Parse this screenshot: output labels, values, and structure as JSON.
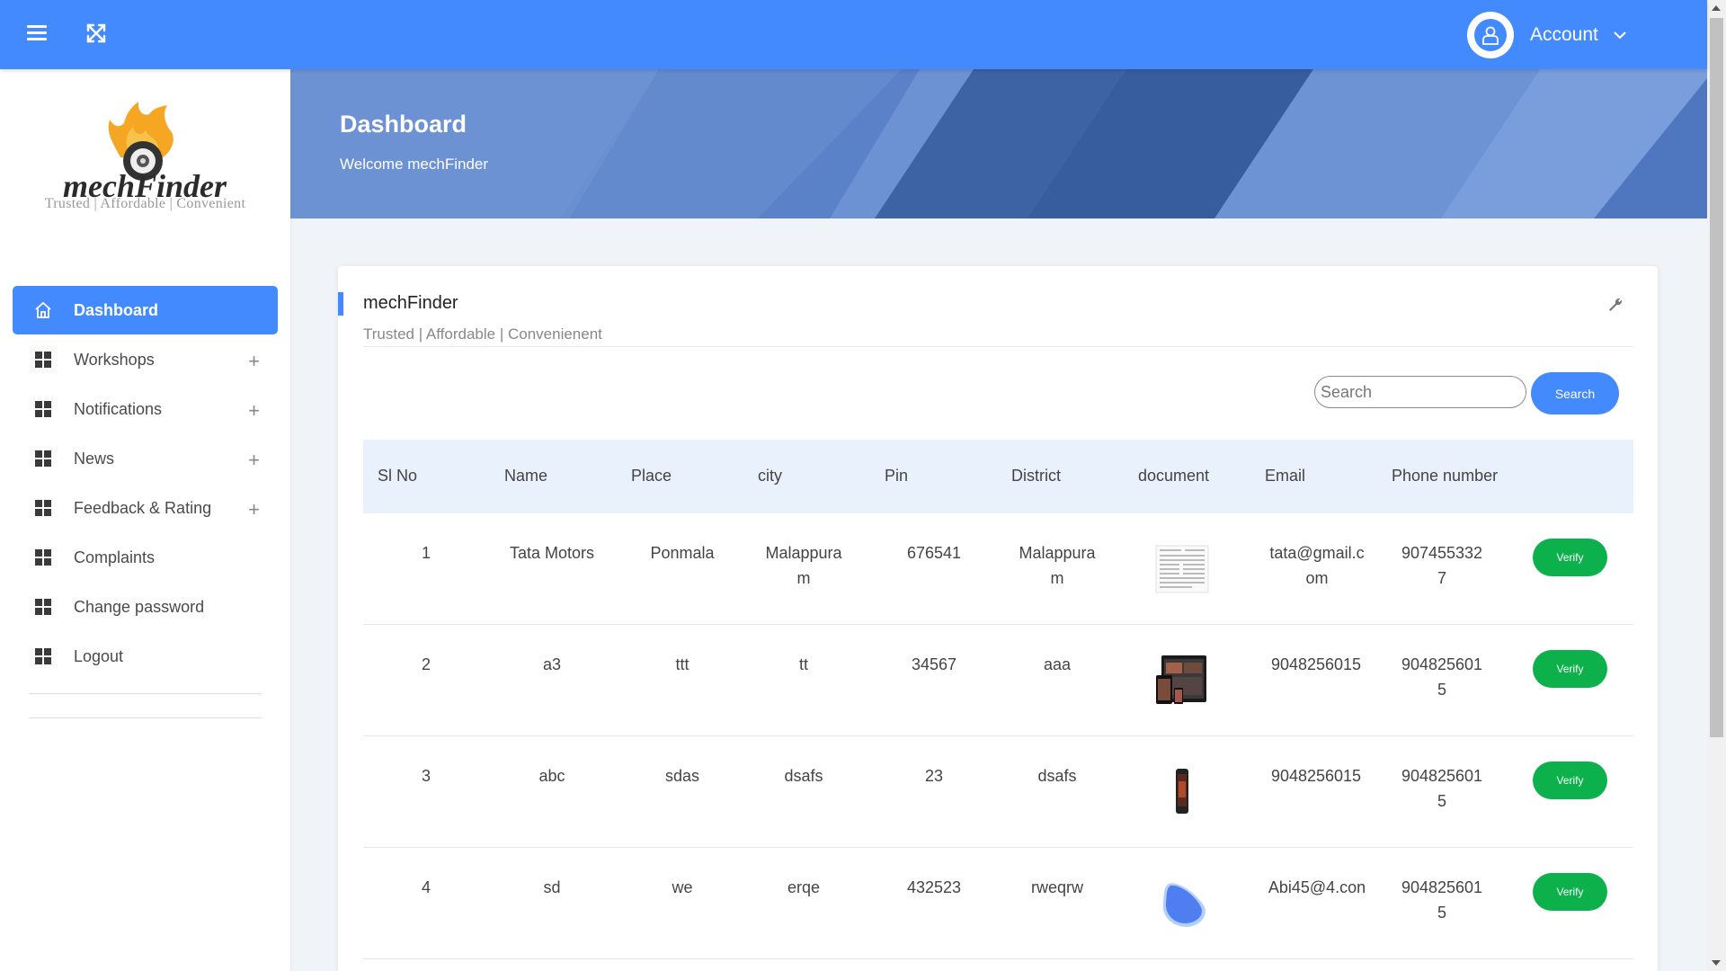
{
  "topbar": {
    "account_label": "Account",
    "icons": [
      "menu-icon",
      "fullscreen-icon",
      "user-icon",
      "chevron-down-icon"
    ]
  },
  "sidebar": {
    "logo_text": "mechFinder",
    "logo_tagline": "Trusted | Affordable | Convenient",
    "items": [
      {
        "label": "Dashboard",
        "icon": "home-icon",
        "active": true,
        "expandable": false
      },
      {
        "label": "Workshops",
        "icon": "grid-icon",
        "active": false,
        "expandable": true
      },
      {
        "label": "Notifications",
        "icon": "grid-icon",
        "active": false,
        "expandable": true
      },
      {
        "label": "News",
        "icon": "grid-icon",
        "active": false,
        "expandable": true
      },
      {
        "label": "Feedback & Rating",
        "icon": "grid-icon",
        "active": false,
        "expandable": true
      },
      {
        "label": "Complaints",
        "icon": "grid-icon",
        "active": false,
        "expandable": false
      },
      {
        "label": "Change password",
        "icon": "grid-icon",
        "active": false,
        "expandable": false
      },
      {
        "label": "Logout",
        "icon": "grid-icon",
        "active": false,
        "expandable": false
      }
    ]
  },
  "banner": {
    "title": "Dashboard",
    "subtitle": "Welcome mechFinder"
  },
  "card": {
    "title": "mechFinder",
    "subtitle": "Trusted | Affordable | Convenienent",
    "search_placeholder": "Search",
    "search_button": "Search"
  },
  "table": {
    "headers": [
      "Sl No",
      "Name",
      "Place",
      "city",
      "Pin",
      "District",
      "document",
      "Email",
      "Phone number"
    ],
    "rows": [
      {
        "sl": "1",
        "name": "Tata Motors",
        "place": "Ponmala",
        "city": "Malappuram",
        "pin": "676541",
        "district": "Malappuram",
        "document": "document-thumbnail",
        "email": "tata@gmail.com",
        "phone": "9074553327",
        "action": "Verify"
      },
      {
        "sl": "2",
        "name": "a3",
        "place": "ttt",
        "city": "tt",
        "pin": "34567",
        "district": "aaa",
        "document": "devices-thumbnail",
        "email": "9048256015",
        "phone": "9048256015",
        "action": "Verify"
      },
      {
        "sl": "3",
        "name": "abc",
        "place": "sdas",
        "city": "dsafs",
        "pin": "23",
        "district": "dsafs",
        "document": "phone-thumbnail",
        "email": "9048256015",
        "phone": "9048256015",
        "action": "Verify"
      },
      {
        "sl": "4",
        "name": "sd",
        "place": "we",
        "city": "erqe",
        "pin": "432523",
        "district": "rweqrw",
        "document": "blob-thumbnail",
        "email": "Abi45@4.con",
        "phone": "9048256015",
        "action": "Verify"
      }
    ]
  },
  "colors": {
    "primary": "#448aff",
    "verify": "#0cb14c",
    "banner": "#6f94d4",
    "header_row": "#e8f1fc"
  }
}
